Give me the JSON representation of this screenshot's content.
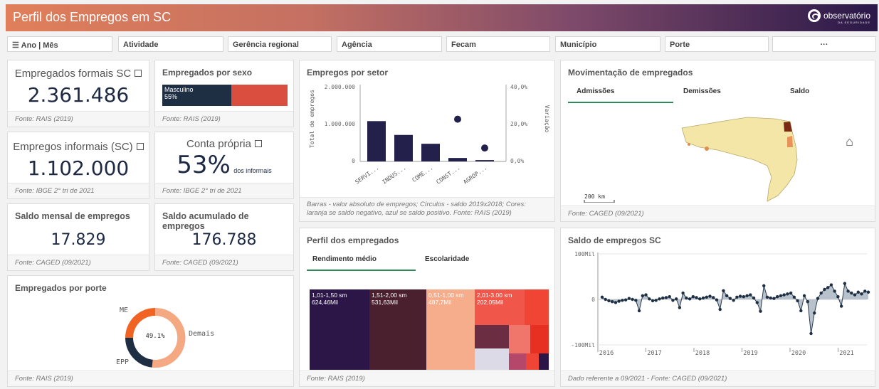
{
  "header": {
    "title": "Perfil dos Empregos em SC",
    "logo_text": "observatório",
    "logo_sub": "DA SEGURIDADE"
  },
  "filters": [
    "Ano | Mês",
    "Atividade",
    "Gerência regional",
    "Agência",
    "Fecam",
    "Município",
    "Porte",
    "···"
  ],
  "kpis": {
    "formais": {
      "label": "Empregados formais SC",
      "value": "2.361.486",
      "source": "Fonte: RAIS (2019)"
    },
    "informais": {
      "label": "Empregos informais (SC)",
      "value": "1.102.000",
      "source": "Fonte: IBGE 2° tri de 2021"
    },
    "conta_propria": {
      "label": "Conta própria",
      "value": "53%",
      "suffix": "dos informais",
      "source": "Fonte: IBGE 2° tri de 2021"
    },
    "saldo_mensal": {
      "label": "Saldo mensal de empregos",
      "value": "17.829",
      "source": "Fonte: CAGED (09/2021)"
    },
    "saldo_acumulado": {
      "label": "Saldo acumulado de empregos",
      "value": "176.788",
      "source": "Fonte: CAGED (09/2021)"
    }
  },
  "sexo": {
    "title": "Empregados por sexo",
    "label": "Masculino",
    "pct": "55%",
    "fraction": 0.55,
    "source": "Fonte: RAIS (2019)",
    "colors": [
      "#1e2f44",
      "#d94e3f"
    ]
  },
  "porte": {
    "title": "Empregados por porte",
    "labels": [
      "ME",
      "Demais",
      "EPP"
    ],
    "center": "49.1%",
    "source": "Fonte: RAIS (2019)"
  },
  "setor": {
    "title": "Empregos por setor",
    "ylabel": "Total de empregos",
    "y2label": "Variação",
    "yticks": [
      "2.000.000",
      "1.000.000",
      "0"
    ],
    "y2ticks": [
      "40,0%",
      "20,0%",
      "0,0%"
    ],
    "note": "Barras - valor absoluto de empregos; Círculos - saldo 2019x2018; Cores: laranja se saldo negativo, azul se saldo positivo. Fonte: RAIS (2019)"
  },
  "chart_data": [
    {
      "type": "bar",
      "title": "Empregos por setor",
      "categories": [
        "SERVI...",
        "INDUS...",
        "COME...",
        "CONST...",
        "AGROP..."
      ],
      "series": [
        {
          "name": "Barras",
          "values": [
            1050000,
            690000,
            460000,
            90000,
            35000
          ]
        },
        {
          "name": "Círculos",
          "values": [
            null,
            null,
            null,
            0.22,
            0.07
          ]
        }
      ],
      "ylabel": "Total de empregos",
      "ylim": [
        0,
        2000000
      ],
      "y2label": "Variação",
      "y2lim": [
        0,
        0.4
      ]
    },
    {
      "type": "line",
      "title": "Saldo de empregos SC",
      "yticks": [
        "100Mil",
        "0",
        "-100Mil"
      ],
      "ylim": [
        -100000,
        100000
      ],
      "xticks": [
        "2016",
        "2017",
        "2018",
        "2019",
        "2020",
        "2021"
      ],
      "values": [
        5000,
        0,
        -3000,
        -5000,
        -7000,
        -4000,
        -2000,
        -1000,
        2000,
        0,
        -2000,
        -25000,
        8000,
        10000,
        1000,
        -3000,
        -2000,
        1000,
        3000,
        4000,
        6000,
        -2000,
        1000,
        -18000,
        14000,
        3000,
        1000,
        6000,
        4000,
        1000,
        3000,
        5000,
        7000,
        4000,
        -1000,
        -22000,
        19000,
        8000,
        2000,
        -2000,
        5000,
        7000,
        6000,
        8000,
        10000,
        3000,
        -7000,
        -26000,
        30000,
        5000,
        3000,
        2000,
        6000,
        8000,
        10000,
        12000,
        14000,
        5000,
        -3000,
        -25000,
        8000,
        -5000,
        -75000,
        -30000,
        2000,
        14000,
        22000,
        26000,
        32000,
        18000,
        6000,
        -15000,
        35000,
        18000,
        14000,
        10000,
        16000,
        12000,
        18000,
        16000
      ]
    }
  ],
  "mov": {
    "title": "Movimentação de empregados",
    "tabs": [
      "Admissões",
      "Demissões",
      "Saldo"
    ],
    "scale": "200 km",
    "source": "Fonte: CAGED (09/2021)"
  },
  "perfil": {
    "title": "Perfil dos empregados",
    "tabs": [
      "Rendimento médio",
      "Escolaridade"
    ],
    "cells": [
      {
        "label": "1,01-1,50 sm",
        "value": "624,46Mil"
      },
      {
        "label": "1,51-2,00 sm",
        "value": "531,63Mil"
      },
      {
        "label": "0,51-1,00 sm",
        "value": "487,7Mil"
      },
      {
        "label": "2,01-3,00 sm",
        "value": "202,05Mil"
      }
    ],
    "source": "Fonte: RAIS (2019)"
  },
  "saldo": {
    "title": "Saldo de empregos SC",
    "source": "Dado referente a 09/2021 - Fonte: CAGED (09/2021)"
  }
}
